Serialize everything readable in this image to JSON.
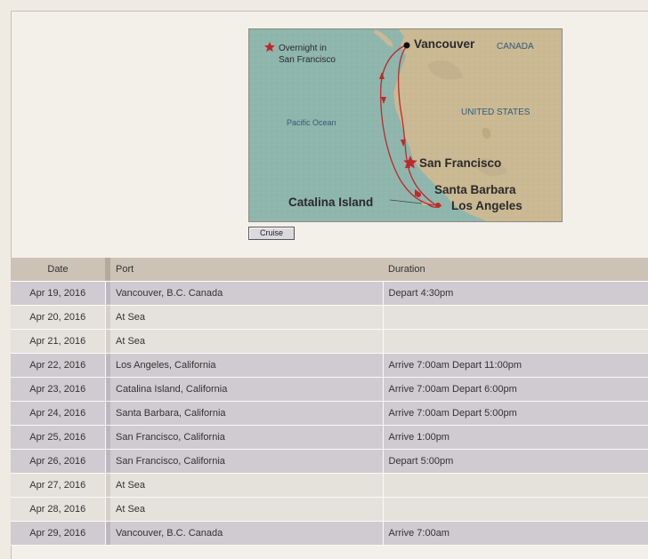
{
  "map": {
    "legend": "Overnight in San Francisco",
    "legend_line1": "Overnight in",
    "legend_line2": "San Francisco",
    "ocean": "Pacific Ocean",
    "country_canada": "CANADA",
    "country_us": "UNITED STATES",
    "cities": {
      "vancouver": "Vancouver",
      "san_francisco": "San Francisco",
      "santa_barbara": "Santa Barbara",
      "los_angeles": "Los Angeles",
      "catalina": "Catalina Island"
    },
    "colors": {
      "sea": "#8fb6ad",
      "land": "#cbb994",
      "route": "#c0282a",
      "star": "#c0282a",
      "label": "#2a2a2a",
      "country": "#2f5c77"
    }
  },
  "button": {
    "label": "Cruise"
  },
  "table": {
    "headers": {
      "date": "Date",
      "port": "Port",
      "duration": "Duration"
    },
    "rows": [
      {
        "date": "Apr 19, 2016",
        "port": "Vancouver, B.C. Canada",
        "duration": "Depart 4:30pm"
      },
      {
        "date": "Apr 20, 2016",
        "port": "At Sea",
        "duration": ""
      },
      {
        "date": "Apr 21, 2016",
        "port": "At Sea",
        "duration": ""
      },
      {
        "date": "Apr 22, 2016",
        "port": "Los Angeles, California",
        "duration": "Arrive 7:00am Depart 11:00pm"
      },
      {
        "date": "Apr 23, 2016",
        "port": "Catalina Island, California",
        "duration": "Arrive 7:00am Depart 6:00pm"
      },
      {
        "date": "Apr 24, 2016",
        "port": "Santa Barbara, California",
        "duration": "Arrive 7:00am Depart 5:00pm"
      },
      {
        "date": "Apr 25, 2016",
        "port": "San Francisco, California",
        "duration": "Arrive 1:00pm"
      },
      {
        "date": "Apr 26, 2016",
        "port": "San Francisco, California",
        "duration": "Depart 5:00pm"
      },
      {
        "date": "Apr 27, 2016",
        "port": "At Sea",
        "duration": ""
      },
      {
        "date": "Apr 28, 2016",
        "port": "At Sea",
        "duration": ""
      },
      {
        "date": "Apr 29, 2016",
        "port": "Vancouver, B.C. Canada",
        "duration": "Arrive 7:00am"
      }
    ]
  }
}
